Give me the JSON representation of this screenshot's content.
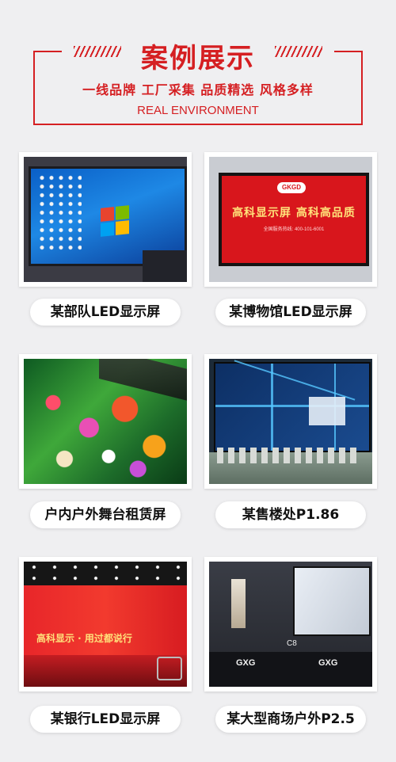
{
  "header": {
    "title": "案例展示",
    "subtitle": "一线品牌 工厂采集 品质精选 风格多样",
    "english": "REAL ENVIRONMENT"
  },
  "cases": [
    {
      "label": "某部队LED显示屏",
      "icon": "desktop-screen-photo"
    },
    {
      "label": "某博物馆LED显示屏",
      "icon": "museum-screen-photo",
      "screen_logo": "GKGD",
      "screen_slogan": "高科显示屏  高科高品质",
      "screen_tel": "全国服务热线: 400-101-6001"
    },
    {
      "label": "户内户外舞台租赁屏",
      "icon": "stage-flower-screen-photo"
    },
    {
      "label": "某售楼处P1.86",
      "icon": "sales-office-map-photo"
    },
    {
      "label": "某银行LED显示屏",
      "icon": "bank-red-screen-photo",
      "screen_slogan": "高科显示 · 用过都说行"
    },
    {
      "label": "某大型商场户外P2.5",
      "icon": "mall-outdoor-screen-photo",
      "store_sign": "GXG",
      "unit_number": "C8"
    }
  ]
}
